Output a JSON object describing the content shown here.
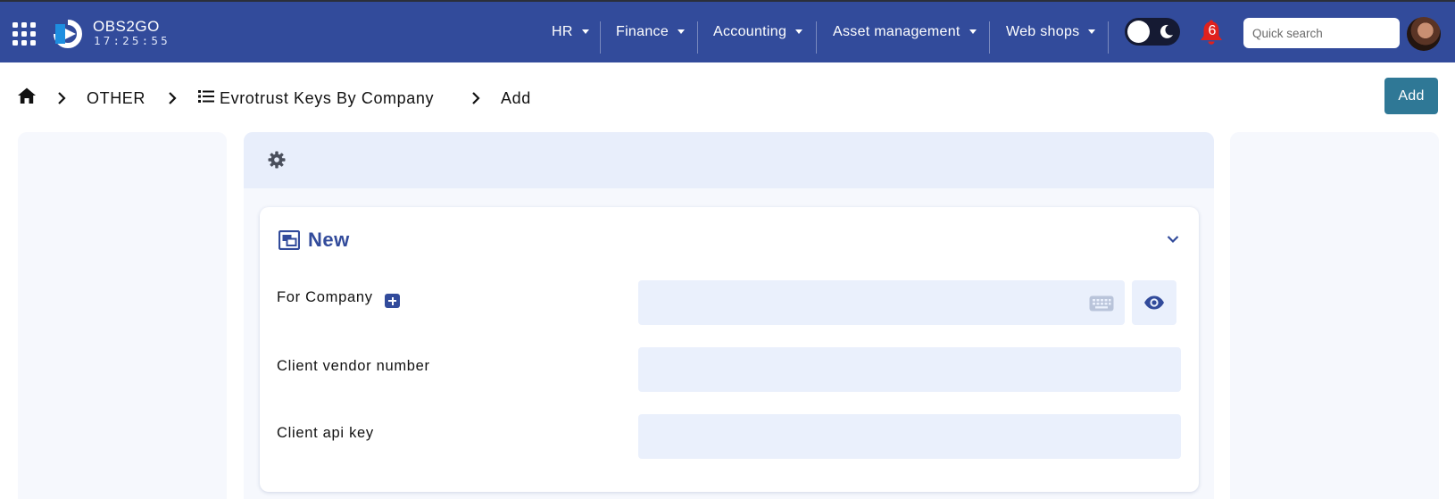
{
  "header": {
    "brand": "OBS2GO",
    "clock": "17:25:55",
    "menus": [
      {
        "label": "HR"
      },
      {
        "label": "Finance"
      },
      {
        "label": "Accounting"
      },
      {
        "label": "Asset management"
      },
      {
        "label": "Web shops"
      }
    ],
    "notifications_count": "6",
    "search_placeholder": "Quick search",
    "theme": "dark-mode-toggle (light active)",
    "colors": {
      "nav_bg": "#324b9b",
      "accent": "#2f7896",
      "badge": "#e02020"
    }
  },
  "breadcrumb": {
    "items": [
      "OTHER",
      "Evrotrust Keys By Company",
      "Add"
    ]
  },
  "actions": {
    "add_label": "Add"
  },
  "form": {
    "title": "New",
    "fields": [
      {
        "label": "For Company",
        "value": "",
        "placeholder": ""
      },
      {
        "label": "Client vendor number",
        "value": "",
        "placeholder": ""
      },
      {
        "label": "Client api key",
        "value": "",
        "placeholder": ""
      }
    ]
  },
  "icons": [
    "apps-grid-icon",
    "logo-icon",
    "moon-icon",
    "bell-icon",
    "home-icon",
    "list-icon",
    "gear-icon",
    "form-window-icon",
    "chevron-down-icon",
    "plus-icon",
    "keyboard-icon",
    "eye-icon"
  ]
}
